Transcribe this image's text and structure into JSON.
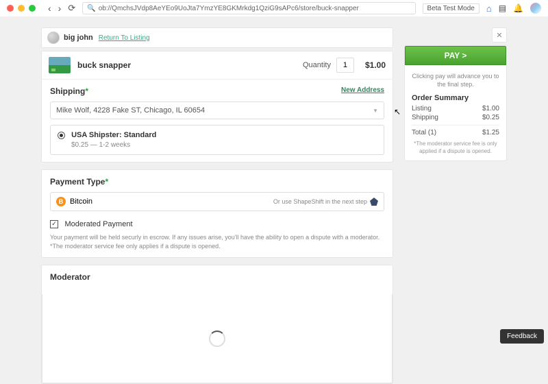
{
  "browser": {
    "url": "ob://QmchsJVdp8AeYEo9UoJta7YmzYE8GKMrkdg1QziG9sAPc6/store/buck-snapper",
    "beta_badge": "Beta Test Mode"
  },
  "seller": {
    "name": "big john",
    "return_link": "Return To Listing"
  },
  "item": {
    "title": "buck snapper",
    "qty_label": "Quantity",
    "qty_value": "1",
    "price": "$1.00"
  },
  "shipping": {
    "title": "Shipping",
    "new_address": "New Address",
    "selected_address": "Mike Wolf, 4228 Fake ST, Chicago, IL 60654",
    "option_name": "USA Shipster: Standard",
    "option_detail": "$0.25 — 1-2 weeks"
  },
  "payment": {
    "title": "Payment Type",
    "coin": "Bitcoin",
    "shapeshift": "Or use ShapeShift in the next step",
    "moderated_label": "Moderated Payment",
    "moderated_desc": "Your payment will be held securly in escrow. If any issues arise, you'll have the ability to open a dispute with a moderator. *The moderator service fee only applies if a dispute is opened."
  },
  "moderator": {
    "title": "Moderator"
  },
  "sidebar": {
    "pay_button": "PAY >",
    "pay_note": "Clicking pay will advance you to the final step.",
    "summary_title": "Order Summary",
    "rows": [
      {
        "label": "Listing",
        "value": "$1.00"
      },
      {
        "label": "Shipping",
        "value": "$0.25"
      }
    ],
    "total_label": "Total (1)",
    "total_value": "$1.25",
    "note": "*The moderator service fee is only applied if a dispute is opened."
  },
  "feedback": "Feedback"
}
